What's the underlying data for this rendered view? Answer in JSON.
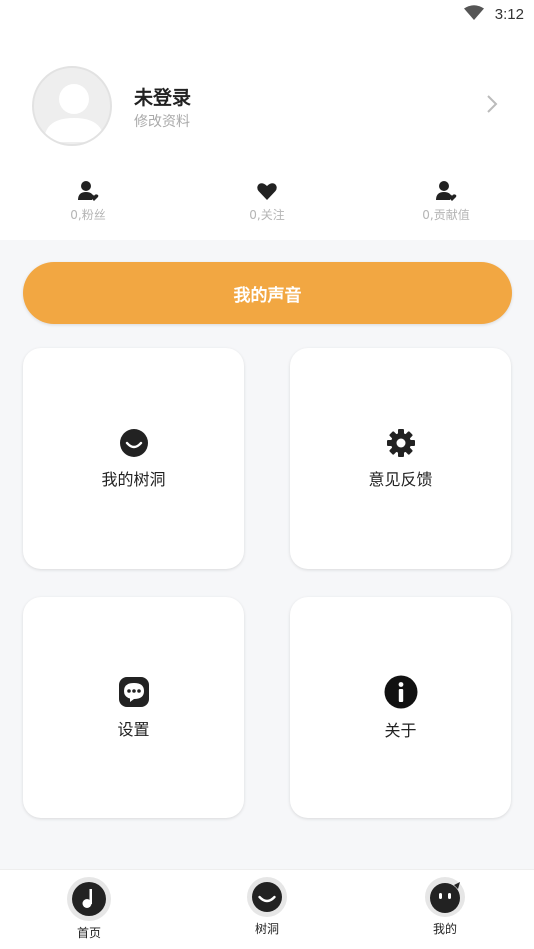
{
  "status_bar": {
    "time": "3:12",
    "wifi_icon": "wifi-icon"
  },
  "profile": {
    "name": "未登录",
    "edit_label": "修改资料",
    "avatar_icon": "user-avatar-icon",
    "chevron_icon": "chevron-right-icon"
  },
  "stats": [
    {
      "label": "0,粉丝",
      "icon": "user-heart-icon"
    },
    {
      "label": "0,关注",
      "icon": "heart-icon"
    },
    {
      "label": "0,贡献值",
      "icon": "user-heart-icon"
    }
  ],
  "voice_button": {
    "label": "我的声音"
  },
  "cards": [
    {
      "label": "我的树洞",
      "icon": "smile-icon"
    },
    {
      "label": "意见反馈",
      "icon": "gear-icon"
    },
    {
      "label": "设置",
      "icon": "chat-bubble-icon"
    },
    {
      "label": "关于",
      "icon": "info-icon"
    }
  ],
  "bottom_nav": [
    {
      "label": "首页",
      "icon": "music-note-icon"
    },
    {
      "label": "树洞",
      "icon": "smile-icon"
    },
    {
      "label": "我的",
      "icon": "face-icon"
    }
  ],
  "colors": {
    "accent": "#f2a742",
    "background": "#f6f7f9",
    "icon_dark": "#222222"
  }
}
